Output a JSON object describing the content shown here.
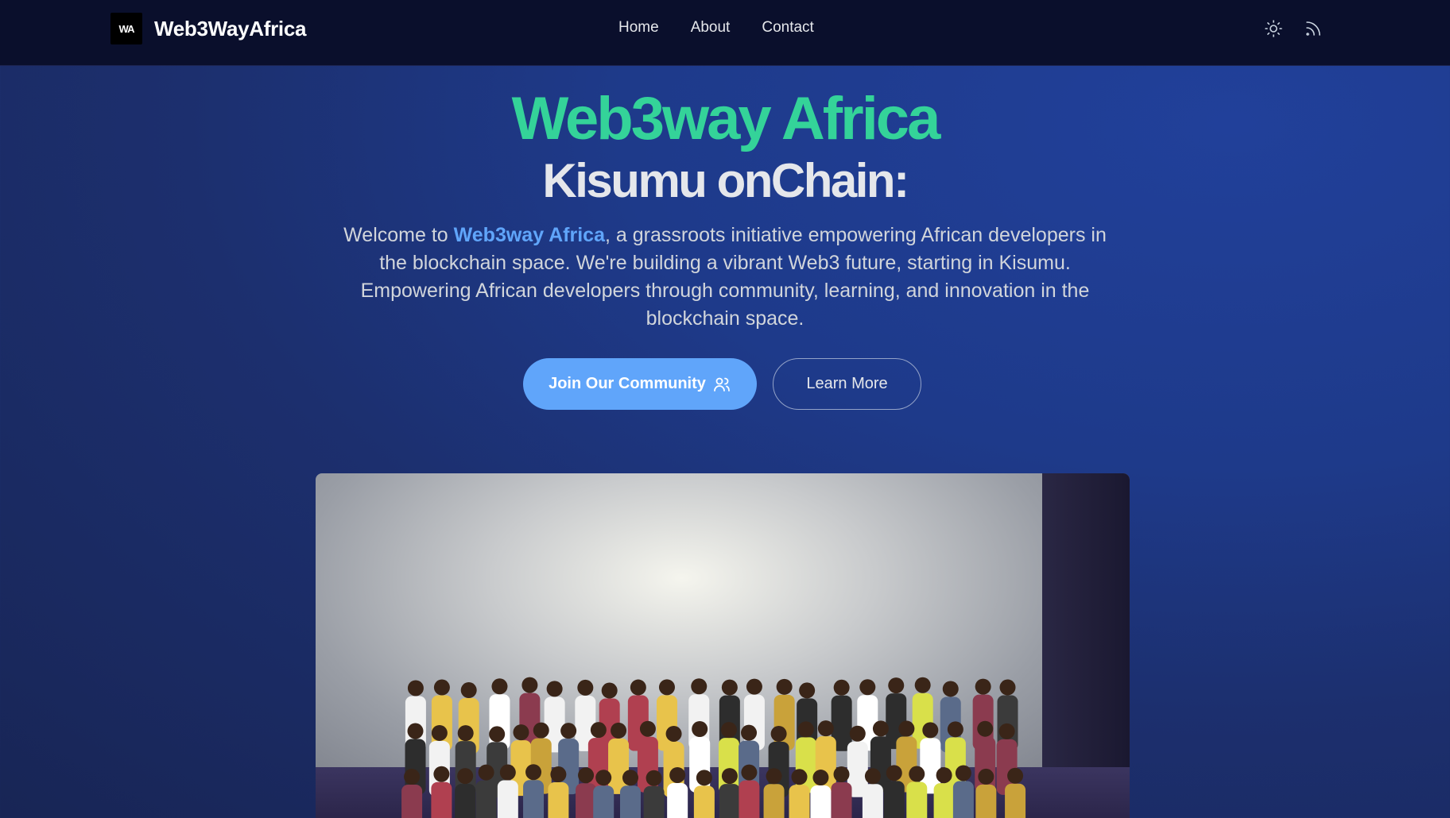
{
  "nav": {
    "brand_logo_text": "WA",
    "brand_name": "Web3WayAfrica",
    "links": [
      "Home",
      "About",
      "Contact"
    ],
    "icons": [
      "sun-icon",
      "rss-icon"
    ]
  },
  "hero": {
    "title": "Web3way Africa",
    "subtitle": "Kisumu onChain:",
    "desc_prefix": "Welcome to ",
    "desc_highlight": "Web3way Africa",
    "desc_suffix": ", a grassroots initiative empowering African developers in the blockchain space. We're building a vibrant Web3 future, starting in Kisumu. Empowering African developers through community, learning, and innovation in the blockchain space.",
    "primary_button": "Join Our Community",
    "secondary_button": "Learn More"
  },
  "colors": {
    "title_green": "#34d399",
    "accent_blue": "#60a5fa",
    "nav_bg": "#0a0f2c"
  }
}
